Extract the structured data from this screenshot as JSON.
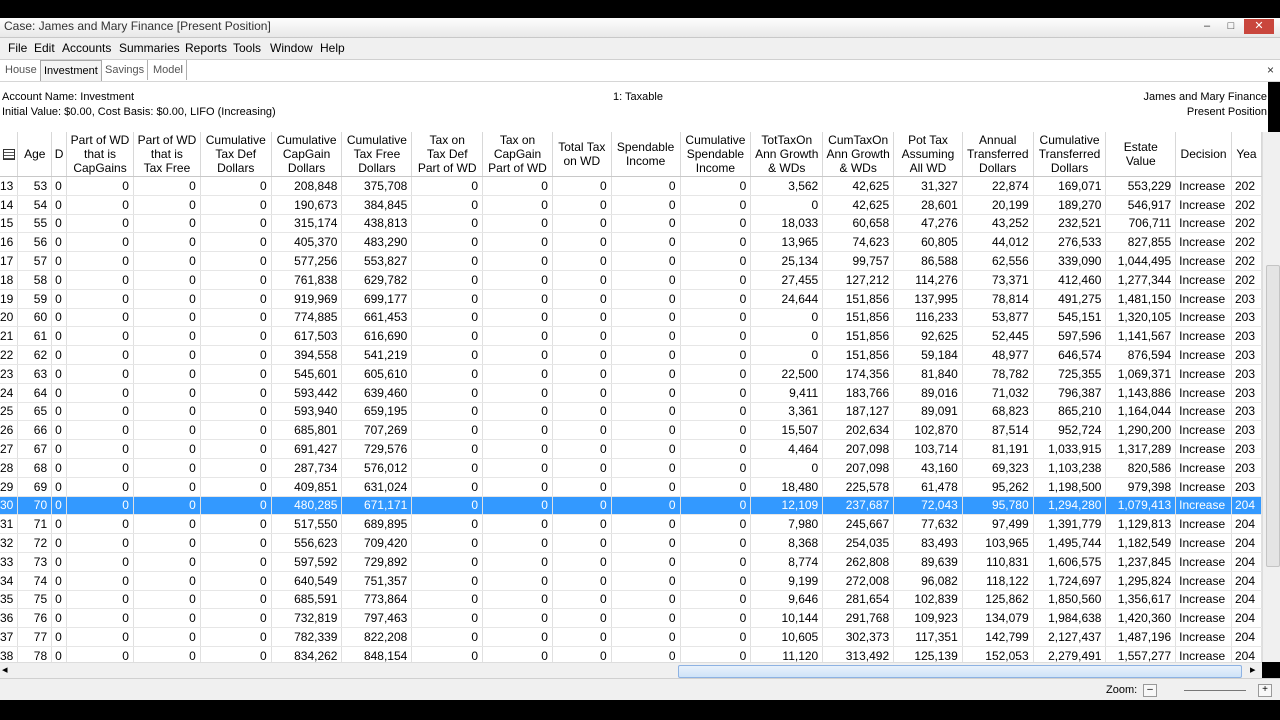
{
  "window": {
    "title": "Case: James and Mary Finance [Present Position]",
    "min": "–",
    "max": "□",
    "close": "✕"
  },
  "menu": [
    "File",
    "Edit",
    "Accounts",
    "Summaries",
    "Reports",
    "Tools",
    "Window",
    "Help"
  ],
  "tabs": [
    "House",
    "Investment",
    "Savings",
    "Model"
  ],
  "tab_close": "×",
  "info": {
    "account_name": "Account Name: Investment",
    "initial_value": "Initial Value: $0.00, Cost Basis: $0.00, LIFO (Increasing)",
    "tax_type": "1: Taxable",
    "client": "James and Mary Finance",
    "position": "Present Position"
  },
  "columns": [
    {
      "l1": "",
      "l2": "",
      "l3": ""
    },
    {
      "l1": "",
      "l2": "Age",
      "l3": ""
    },
    {
      "l1": "D",
      "l2": "",
      "l3": ""
    },
    {
      "l1": "Part of WD",
      "l2": "that is",
      "l3": "CapGains"
    },
    {
      "l1": "Part of WD",
      "l2": "that is",
      "l3": "Tax Free"
    },
    {
      "l1": "Cumulative",
      "l2": "Tax Def",
      "l3": "Dollars"
    },
    {
      "l1": "Cumulative",
      "l2": "CapGain",
      "l3": "Dollars"
    },
    {
      "l1": "Cumulative",
      "l2": "Tax Free",
      "l3": "Dollars"
    },
    {
      "l1": "Tax on",
      "l2": "Tax Def",
      "l3": "Part of WD"
    },
    {
      "l1": "Tax on",
      "l2": "CapGain",
      "l3": "Part of WD"
    },
    {
      "l1": "Total Tax",
      "l2": "on WD",
      "l3": ""
    },
    {
      "l1": "Spendable",
      "l2": "Income",
      "l3": ""
    },
    {
      "l1": "Cumulative",
      "l2": "Spendable",
      "l3": "Income"
    },
    {
      "l1": "TotTaxOn",
      "l2": "Ann Growth",
      "l3": "& WDs"
    },
    {
      "l1": "CumTaxOn",
      "l2": "Ann Growth",
      "l3": "& WDs"
    },
    {
      "l1": "Pot Tax",
      "l2": "Assuming",
      "l3": "All WD"
    },
    {
      "l1": "Annual",
      "l2": "Transferred",
      "l3": "Dollars"
    },
    {
      "l1": "Cumulative",
      "l2": "Transferred",
      "l3": "Dollars"
    },
    {
      "l1": "Estate",
      "l2": "Value",
      "l3": ""
    },
    {
      "l1": "",
      "l2": "Decision",
      "l3": ""
    },
    {
      "l1": "",
      "l2": "Yea",
      "l3": ""
    }
  ],
  "selected_row": 17,
  "rows": [
    [
      "13",
      "53",
      "0",
      "0",
      "0",
      "0",
      "208,848",
      "375,708",
      "0",
      "0",
      "0",
      "0",
      "0",
      "3,562",
      "42,625",
      "31,327",
      "22,874",
      "169,071",
      "553,229",
      "Increase",
      "202"
    ],
    [
      "14",
      "54",
      "0",
      "0",
      "0",
      "0",
      "190,673",
      "384,845",
      "0",
      "0",
      "0",
      "0",
      "0",
      "0",
      "42,625",
      "28,601",
      "20,199",
      "189,270",
      "546,917",
      "Increase",
      "202"
    ],
    [
      "15",
      "55",
      "0",
      "0",
      "0",
      "0",
      "315,174",
      "438,813",
      "0",
      "0",
      "0",
      "0",
      "0",
      "18,033",
      "60,658",
      "47,276",
      "43,252",
      "232,521",
      "706,711",
      "Increase",
      "202"
    ],
    [
      "16",
      "56",
      "0",
      "0",
      "0",
      "0",
      "405,370",
      "483,290",
      "0",
      "0",
      "0",
      "0",
      "0",
      "13,965",
      "74,623",
      "60,805",
      "44,012",
      "276,533",
      "827,855",
      "Increase",
      "202"
    ],
    [
      "17",
      "57",
      "0",
      "0",
      "0",
      "0",
      "577,256",
      "553,827",
      "0",
      "0",
      "0",
      "0",
      "0",
      "25,134",
      "99,757",
      "86,588",
      "62,556",
      "339,090",
      "1,044,495",
      "Increase",
      "202"
    ],
    [
      "18",
      "58",
      "0",
      "0",
      "0",
      "0",
      "761,838",
      "629,782",
      "0",
      "0",
      "0",
      "0",
      "0",
      "27,455",
      "127,212",
      "114,276",
      "73,371",
      "412,460",
      "1,277,344",
      "Increase",
      "202"
    ],
    [
      "19",
      "59",
      "0",
      "0",
      "0",
      "0",
      "919,969",
      "699,177",
      "0",
      "0",
      "0",
      "0",
      "0",
      "24,644",
      "151,856",
      "137,995",
      "78,814",
      "491,275",
      "1,481,150",
      "Increase",
      "203"
    ],
    [
      "20",
      "60",
      "0",
      "0",
      "0",
      "0",
      "774,885",
      "661,453",
      "0",
      "0",
      "0",
      "0",
      "0",
      "0",
      "151,856",
      "116,233",
      "53,877",
      "545,151",
      "1,320,105",
      "Increase",
      "203"
    ],
    [
      "21",
      "61",
      "0",
      "0",
      "0",
      "0",
      "617,503",
      "616,690",
      "0",
      "0",
      "0",
      "0",
      "0",
      "0",
      "151,856",
      "92,625",
      "52,445",
      "597,596",
      "1,141,567",
      "Increase",
      "203"
    ],
    [
      "22",
      "62",
      "0",
      "0",
      "0",
      "0",
      "394,558",
      "541,219",
      "0",
      "0",
      "0",
      "0",
      "0",
      "0",
      "151,856",
      "59,184",
      "48,977",
      "646,574",
      "876,594",
      "Increase",
      "203"
    ],
    [
      "23",
      "63",
      "0",
      "0",
      "0",
      "0",
      "545,601",
      "605,610",
      "0",
      "0",
      "0",
      "0",
      "0",
      "22,500",
      "174,356",
      "81,840",
      "78,782",
      "725,355",
      "1,069,371",
      "Increase",
      "203"
    ],
    [
      "24",
      "64",
      "0",
      "0",
      "0",
      "0",
      "593,442",
      "639,460",
      "0",
      "0",
      "0",
      "0",
      "0",
      "9,411",
      "183,766",
      "89,016",
      "71,032",
      "796,387",
      "1,143,886",
      "Increase",
      "203"
    ],
    [
      "25",
      "65",
      "0",
      "0",
      "0",
      "0",
      "593,940",
      "659,195",
      "0",
      "0",
      "0",
      "0",
      "0",
      "3,361",
      "187,127",
      "89,091",
      "68,823",
      "865,210",
      "1,164,044",
      "Increase",
      "203"
    ],
    [
      "26",
      "66",
      "0",
      "0",
      "0",
      "0",
      "685,801",
      "707,269",
      "0",
      "0",
      "0",
      "0",
      "0",
      "15,507",
      "202,634",
      "102,870",
      "87,514",
      "952,724",
      "1,290,200",
      "Increase",
      "203"
    ],
    [
      "27",
      "67",
      "0",
      "0",
      "0",
      "0",
      "691,427",
      "729,576",
      "0",
      "0",
      "0",
      "0",
      "0",
      "4,464",
      "207,098",
      "103,714",
      "81,191",
      "1,033,915",
      "1,317,289",
      "Increase",
      "203"
    ],
    [
      "28",
      "68",
      "0",
      "0",
      "0",
      "0",
      "287,734",
      "576,012",
      "0",
      "0",
      "0",
      "0",
      "0",
      "0",
      "207,098",
      "43,160",
      "69,323",
      "1,103,238",
      "820,586",
      "Increase",
      "203"
    ],
    [
      "29",
      "69",
      "0",
      "0",
      "0",
      "0",
      "409,851",
      "631,024",
      "0",
      "0",
      "0",
      "0",
      "0",
      "18,480",
      "225,578",
      "61,478",
      "95,262",
      "1,198,500",
      "979,398",
      "Increase",
      "203"
    ],
    [
      "30",
      "70",
      "0",
      "0",
      "0",
      "0",
      "480,285",
      "671,171",
      "0",
      "0",
      "0",
      "0",
      "0",
      "12,109",
      "237,687",
      "72,043",
      "95,780",
      "1,294,280",
      "1,079,413",
      "Increase",
      "204"
    ],
    [
      "31",
      "71",
      "0",
      "0",
      "0",
      "0",
      "517,550",
      "689,895",
      "0",
      "0",
      "0",
      "0",
      "0",
      "7,980",
      "245,667",
      "77,632",
      "97,499",
      "1,391,779",
      "1,129,813",
      "Increase",
      "204"
    ],
    [
      "32",
      "72",
      "0",
      "0",
      "0",
      "0",
      "556,623",
      "709,420",
      "0",
      "0",
      "0",
      "0",
      "0",
      "8,368",
      "254,035",
      "83,493",
      "103,965",
      "1,495,744",
      "1,182,549",
      "Increase",
      "204"
    ],
    [
      "33",
      "73",
      "0",
      "0",
      "0",
      "0",
      "597,592",
      "729,892",
      "0",
      "0",
      "0",
      "0",
      "0",
      "8,774",
      "262,808",
      "89,639",
      "110,831",
      "1,606,575",
      "1,237,845",
      "Increase",
      "204"
    ],
    [
      "34",
      "74",
      "0",
      "0",
      "0",
      "0",
      "640,549",
      "751,357",
      "0",
      "0",
      "0",
      "0",
      "0",
      "9,199",
      "272,008",
      "96,082",
      "118,122",
      "1,724,697",
      "1,295,824",
      "Increase",
      "204"
    ],
    [
      "35",
      "75",
      "0",
      "0",
      "0",
      "0",
      "685,591",
      "773,864",
      "0",
      "0",
      "0",
      "0",
      "0",
      "9,646",
      "281,654",
      "102,839",
      "125,862",
      "1,850,560",
      "1,356,617",
      "Increase",
      "204"
    ],
    [
      "36",
      "76",
      "0",
      "0",
      "0",
      "0",
      "732,819",
      "797,463",
      "0",
      "0",
      "0",
      "0",
      "0",
      "10,144",
      "291,768",
      "109,923",
      "134,079",
      "1,984,638",
      "1,420,360",
      "Increase",
      "204"
    ],
    [
      "37",
      "77",
      "0",
      "0",
      "0",
      "0",
      "782,339",
      "822,208",
      "0",
      "0",
      "0",
      "0",
      "0",
      "10,605",
      "302,373",
      "117,351",
      "142,799",
      "2,127,437",
      "1,487,196",
      "Increase",
      "204"
    ],
    [
      "38",
      "78",
      "0",
      "0",
      "0",
      "0",
      "834,262",
      "848,154",
      "0",
      "0",
      "0",
      "0",
      "0",
      "11,120",
      "313,492",
      "125,139",
      "152,053",
      "2,279,491",
      "1,557,277",
      "Increase",
      "204"
    ]
  ],
  "status": {
    "zoom_label": "Zoom:",
    "zoom_minus": "–",
    "zoom_plus": "+"
  },
  "icons": {
    "grid_corner": "table-icon",
    "scroll_left": "◂",
    "scroll_right": "▸",
    "scroll_up": "▴",
    "scroll_down": "▾"
  }
}
